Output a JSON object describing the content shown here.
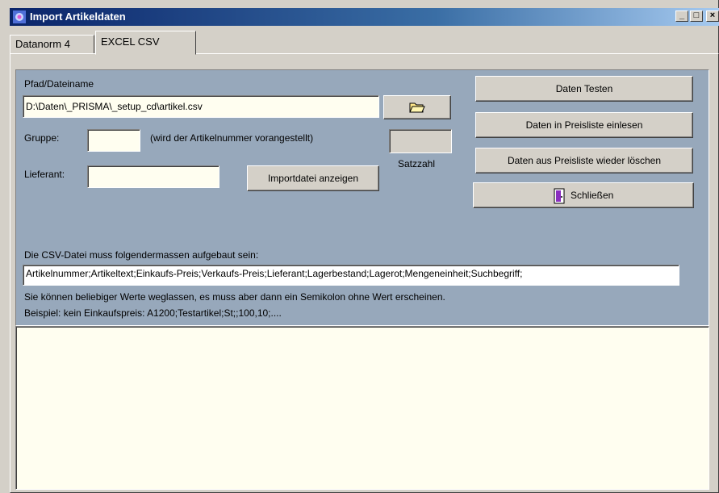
{
  "window": {
    "title": "Import Artikeldaten",
    "min": "_",
    "max": "□",
    "close": "×"
  },
  "tabs": [
    {
      "label": "Datanorm 4"
    },
    {
      "label": "EXCEL CSV"
    }
  ],
  "form": {
    "path_label": "Pfad/Dateiname",
    "path_value": "D:\\Daten\\_PRISMA\\_setup_cd\\artikel.csv",
    "group_label": "Gruppe:",
    "group_value": "",
    "group_hint": "(wird der Artikelnummer vorangestellt)",
    "supplier_label": "Lieferant:",
    "supplier_value": "",
    "count_label": "Satzzahl",
    "count_value": "",
    "show_file_button": "Importdatei anzeigen"
  },
  "actions": {
    "test": "Daten Testen",
    "import": "Daten in Preisliste einlesen",
    "delete": "Daten aus Preisliste wieder löschen",
    "close": "Schließen"
  },
  "info": {
    "heading": "Die CSV-Datei muss folgendermassen aufgebaut sein:",
    "format": "Artikelnummer;Artikeltext;Einkaufs-Preis;Verkaufs-Preis;Lieferant;Lagerbestand;Lagerot;Mengeneinheit;Suchbegriff;",
    "note": "Sie können beliebiger Werte weglassen, es muss aber dann ein Semikolon ohne Wert erscheinen.",
    "example": "Beispiel: kein Einkaufspreis:   A1200;Testartikel;St;;100,10;...."
  },
  "colors": {
    "panel_blue": "#97a8bb",
    "field_bg": "#fffef0",
    "titlebar": "#0a246a"
  }
}
